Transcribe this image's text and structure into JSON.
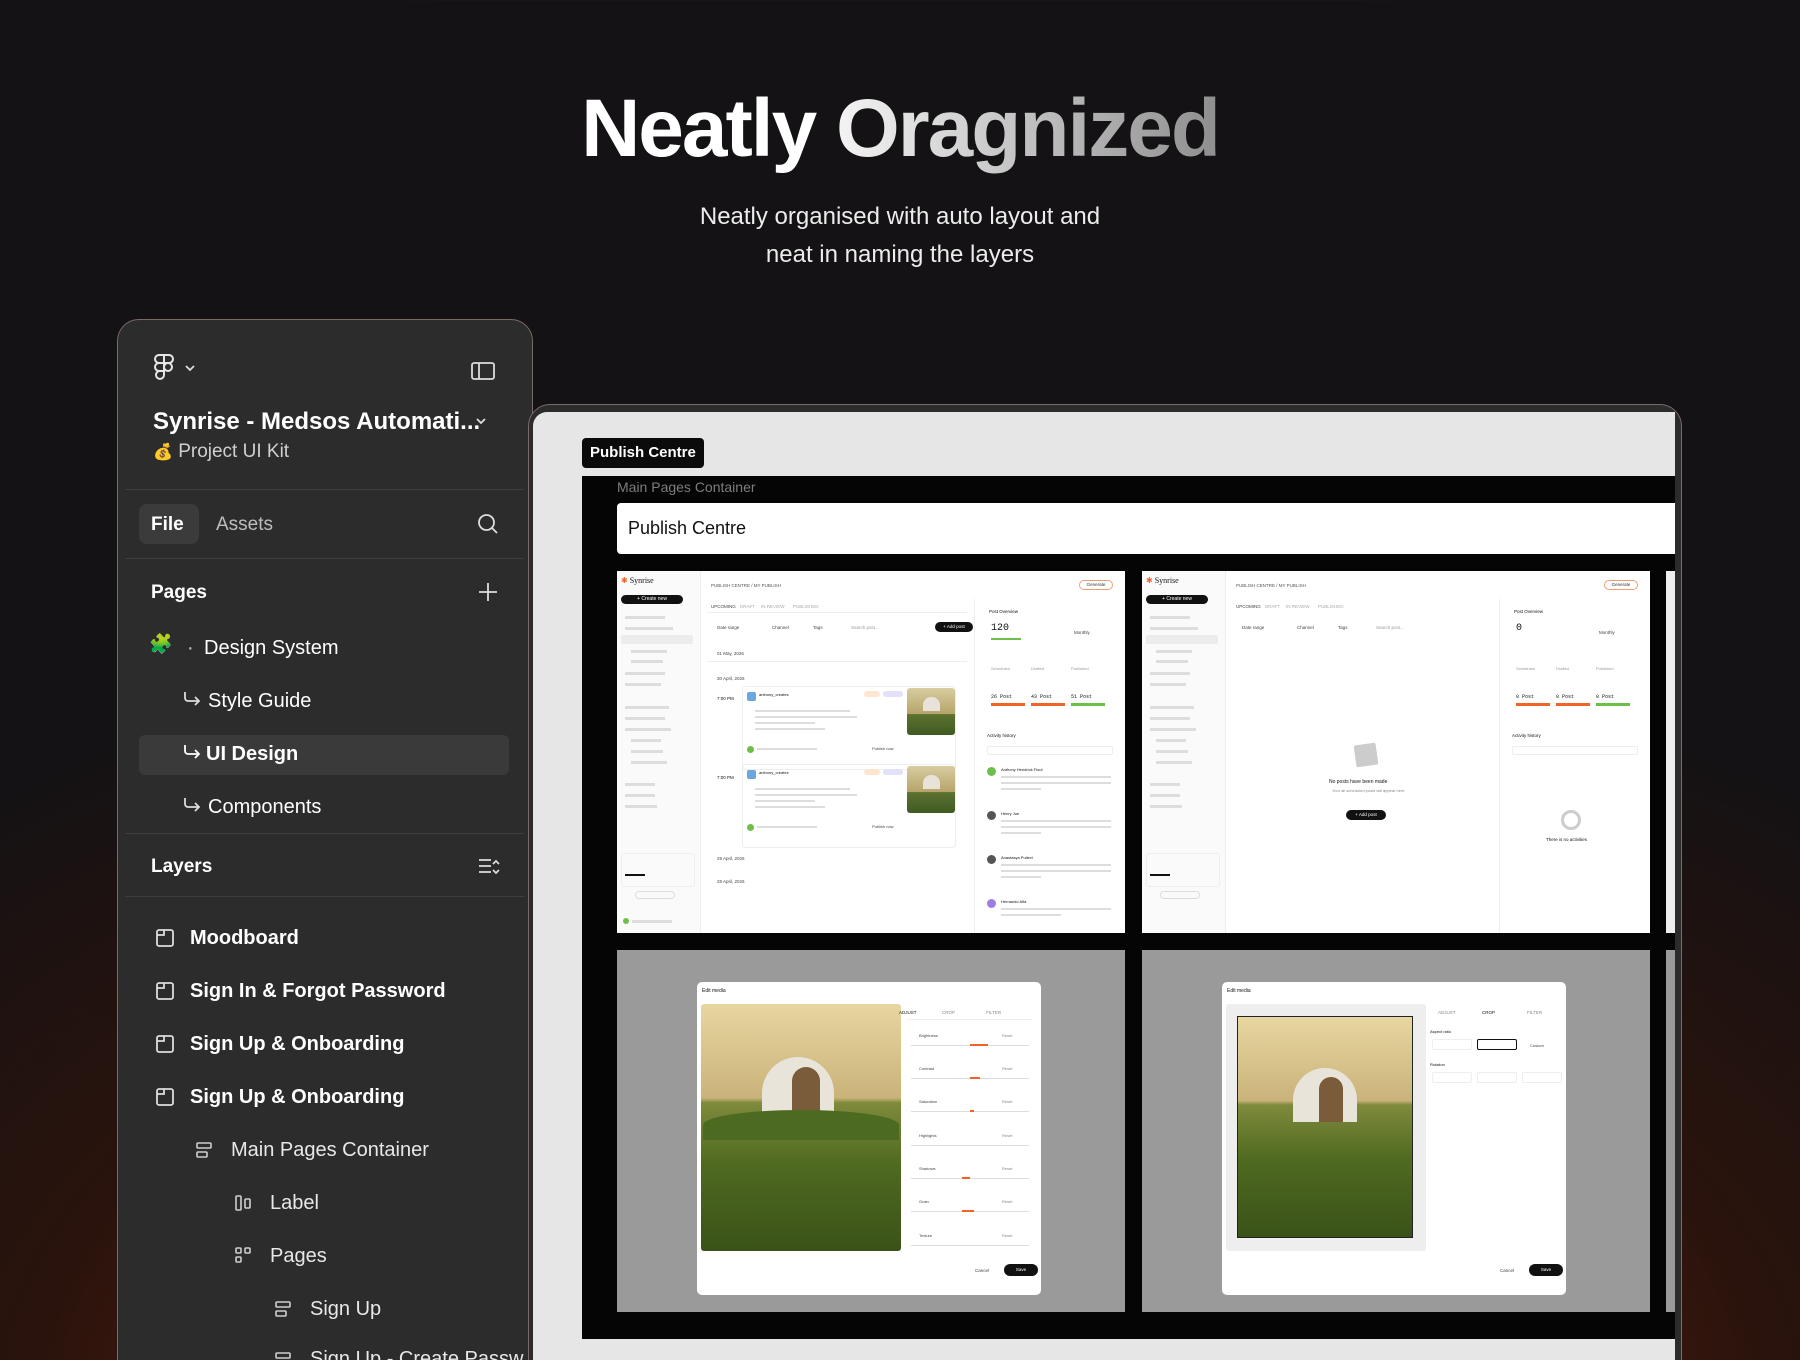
{
  "hero": {
    "title_plain": "Neatly",
    "title_grad": "Oragnized",
    "subtitle_line1": "Neatly organised with auto layout and",
    "subtitle_line2": "neat in naming the layers"
  },
  "panel": {
    "project_name": "Synrise - Medsos Automati...",
    "project_sub": "Project UI Kit",
    "tabs": [
      "File",
      "Assets"
    ],
    "pages_title": "Pages",
    "pages": [
      {
        "label": "Design System",
        "kind": "section"
      },
      {
        "label": "Style Guide",
        "kind": "sub"
      },
      {
        "label": "UI Design",
        "kind": "sub",
        "selected": true
      },
      {
        "label": "Components",
        "kind": "sub"
      }
    ],
    "layers_title": "Layers",
    "layers": [
      {
        "label": "Moodboard",
        "level": 0,
        "icon": "frame-icon",
        "bold": true
      },
      {
        "label": "Sign In & Forgot Password",
        "level": 0,
        "icon": "frame-icon",
        "bold": true
      },
      {
        "label": "Sign Up & Onboarding",
        "level": 0,
        "icon": "frame-icon",
        "bold": true
      },
      {
        "label": "Sign Up & Onboarding",
        "level": 0,
        "icon": "frame-icon",
        "bold": true
      },
      {
        "label": "Main Pages Container",
        "level": 1,
        "icon": "autolayout-vertical-icon",
        "bold": false
      },
      {
        "label": "Label",
        "level": 2,
        "icon": "autolayout-horizontal-icon",
        "bold": false
      },
      {
        "label": "Pages",
        "level": 2,
        "icon": "autolayout-grid-icon",
        "bold": false
      },
      {
        "label": "Sign Up",
        "level": 3,
        "icon": "autolayout-vertical-icon",
        "bold": false
      },
      {
        "label": "Sign Up - Create Passw",
        "level": 3,
        "icon": "autolayout-vertical-icon",
        "bold": false
      }
    ]
  },
  "canvas": {
    "tag": "Publish Centre",
    "container_label": "Main Pages Container",
    "page_title": "Publish Centre",
    "shot1": {
      "brand": "Synrise",
      "create": "+ Create new",
      "breadcrumb": "PUBLISH CENTRE  /  MY PUBLISH",
      "generate": "Generate",
      "tabs": [
        "UPCOMING",
        "DRAFT",
        "IN REVIEW",
        "PUBLISHED"
      ],
      "filters": [
        "Date range",
        "Channel",
        "Tags",
        "Search post..."
      ],
      "add_post": "+ Add post",
      "date1": "01 May, 2026",
      "date2": "30 April, 2026",
      "date3": "29 April, 2026",
      "date4": "28 April, 2026",
      "time1": "7:00 PM",
      "time2": "7:00 PM",
      "user1": "anthony_creates",
      "user2": "anthony_creates",
      "publish": "Publish now",
      "overview": "Post Overview",
      "count": "120",
      "monthly": "Monthly",
      "stat_labels": [
        "Scheduled",
        "Drafted",
        "Published"
      ],
      "stat_values": [
        "26 Post",
        "43 Post",
        "51 Post"
      ],
      "activity": "Activity history",
      "acts": [
        "Anthony Hendrick Flout",
        "Henry Joe",
        "Anastasya Putievi",
        "Hernando Alfa"
      ]
    },
    "shot2": {
      "empty_title": "No posts have been made",
      "empty_sub": "Your all scheduled posts will appear here",
      "add_post": "+ Add post",
      "count": "0",
      "stat_values": [
        "0 Post",
        "0 Post",
        "0 Post"
      ],
      "no_act": "There is no activities"
    },
    "shot3": {
      "title": "Edit media",
      "tabs": [
        "ADJUST",
        "CROP",
        "FILTER"
      ],
      "adjust": [
        "Brightness",
        "Contrast",
        "Saturation",
        "Highlights",
        "Shadows",
        "Grain",
        "Texture"
      ],
      "reset": "Reset",
      "cancel": "Cancel",
      "save": "Save"
    },
    "shot4": {
      "title": "Edit media",
      "tabs": [
        "ADJUST",
        "CROP",
        "FILTER"
      ],
      "aspect": "Aspect ratio",
      "rotation": "Rotation",
      "custom": "Custom",
      "cancel": "Cancel",
      "save": "Save"
    }
  },
  "colors": {
    "accent": "#f0632a",
    "panel_bg": "#2c2c2c",
    "selected": "#3a3a3a"
  }
}
